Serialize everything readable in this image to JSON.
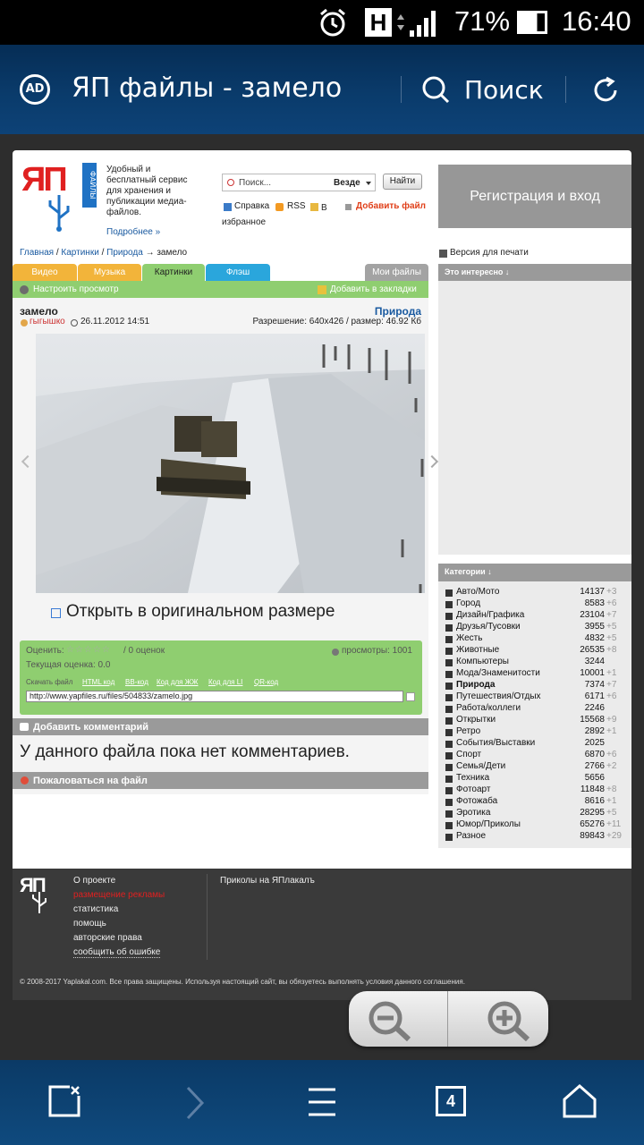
{
  "status": {
    "battery": "71%",
    "time": "16:40",
    "network": "H"
  },
  "appbar": {
    "title": "ЯП файлы - замело",
    "search_label": "Поиск",
    "ad_label": "AD"
  },
  "site": {
    "logo_text": "ЯП",
    "logo_sub": "ФАЙЛЫ",
    "tagline": "Удобный и бесплатный сервис для хранения и публикации медиа-файлов.",
    "more_link": "Подробнее »",
    "search_placeholder": "Поиск...",
    "search_scope": "Везде",
    "search_button": "Найти",
    "help_link": "Справка",
    "rss_link": "RSS",
    "fav_link": "В избранное",
    "add_file_link": "Добавить файл",
    "register": "Регистрация и вход",
    "breadcrumb": {
      "home": "Главная",
      "pictures": "Картинки",
      "nature": "Природа",
      "current": "→ замело"
    },
    "print_version": "Версия для печати",
    "tabs": [
      "Видео",
      "Музыка",
      "Картинки",
      "Флэш"
    ],
    "my_files": "Мои файлы",
    "customize": "Настроить просмотр",
    "bookmark": "Добавить в закладки",
    "interesting": "Это интересно ↓",
    "file": {
      "title": "замело",
      "category": "Природа",
      "author": "гыгышко",
      "date": "26.11.2012 14:51",
      "resolution": "Разрешение: 640x426 / размер: 46.92 Кб",
      "open_original": "Открыть в оригинальном размере"
    },
    "rating": {
      "label": "Оценить:",
      "count": "/ 0 оценок",
      "views": "просмотры: 1001",
      "current": "Текущая оценка: 0.0"
    },
    "codes": {
      "download": "Скачать файл",
      "html": "HTML код",
      "bb": "BB-код",
      "lj": "Код для ЖЖ",
      "li": "Код для LI",
      "qr": "QR-код",
      "url": "http://www.yapfiles.ru/files/504833/zamelo.jpg"
    },
    "add_comment": "Добавить комментарий",
    "no_comments": "У данного файла пока нет комментариев.",
    "complain": "Пожаловаться на файл",
    "categories_title": "Категории ↓",
    "categories": [
      {
        "name": "Авто/Мото",
        "count": "14137",
        "delta": "+3",
        "bold": false
      },
      {
        "name": "Город",
        "count": "8583",
        "delta": "+6",
        "bold": false
      },
      {
        "name": "Дизайн/Графика",
        "count": "23104",
        "delta": "+7",
        "bold": false
      },
      {
        "name": "Друзья/Тусовки",
        "count": "3955",
        "delta": "+5",
        "bold": false
      },
      {
        "name": "Жесть",
        "count": "4832",
        "delta": "+5",
        "bold": false
      },
      {
        "name": "Животные",
        "count": "26535",
        "delta": "+8",
        "bold": false
      },
      {
        "name": "Компьютеры",
        "count": "3244",
        "delta": "",
        "bold": false
      },
      {
        "name": "Мода/Знаменитости",
        "count": "10001",
        "delta": "+1",
        "bold": false
      },
      {
        "name": "Природа",
        "count": "7374",
        "delta": "+7",
        "bold": true
      },
      {
        "name": "Путешествия/Отдых",
        "count": "6171",
        "delta": "+6",
        "bold": false
      },
      {
        "name": "Работа/коллеги",
        "count": "2246",
        "delta": "",
        "bold": false
      },
      {
        "name": "Открытки",
        "count": "15568",
        "delta": "+9",
        "bold": false
      },
      {
        "name": "Ретро",
        "count": "2892",
        "delta": "+1",
        "bold": false
      },
      {
        "name": "События/Выставки",
        "count": "2025",
        "delta": "",
        "bold": false
      },
      {
        "name": "Спорт",
        "count": "6870",
        "delta": "+6",
        "bold": false
      },
      {
        "name": "Семья/Дети",
        "count": "2766",
        "delta": "+2",
        "bold": false
      },
      {
        "name": "Техника",
        "count": "5656",
        "delta": "",
        "bold": false
      },
      {
        "name": "Фотоарт",
        "count": "11848",
        "delta": "+8",
        "bold": false
      },
      {
        "name": "Фотожаба",
        "count": "8616",
        "delta": "+1",
        "bold": false
      },
      {
        "name": "Эротика",
        "count": "28295",
        "delta": "+5",
        "bold": false
      },
      {
        "name": "Юмор/Приколы",
        "count": "65276",
        "delta": "+11",
        "bold": false
      },
      {
        "name": "Разное",
        "count": "89843",
        "delta": "+29",
        "bold": false
      }
    ],
    "footer": {
      "links": [
        "О проекте",
        "размещение рекламы",
        "статистика",
        "помощь",
        "авторские права",
        "сообщить об ошибке"
      ],
      "jokes": "Приколы на ЯПлакалъ",
      "copyright": "© 2008-2017 Yaplakal.com. Все права защищены. Используя настоящий сайт, вы обязуетесь выполнять условия данного соглашения."
    }
  },
  "navbar": {
    "tabs_count": "4"
  },
  "colors": {
    "green": "#8fce70",
    "orange": "#f2b43a",
    "blue": "#2aa6dc",
    "red": "#e02020",
    "brand_blue": "#1f72c4"
  }
}
